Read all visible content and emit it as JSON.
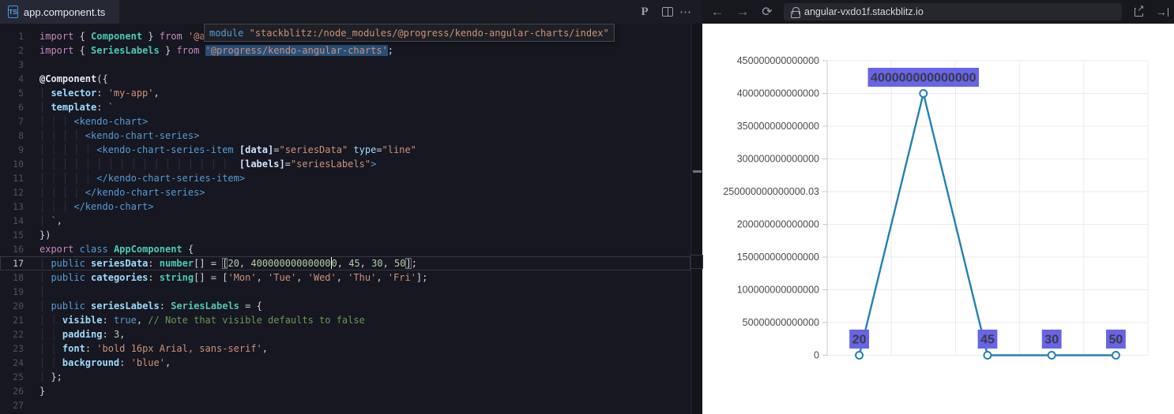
{
  "topbar": {
    "tab": {
      "file_icon": "TS",
      "name": "app.component.ts",
      "modified": true
    },
    "icons": [
      {
        "name": "prettier-icon",
        "glyph": "P"
      },
      {
        "name": "split-editor-icon"
      },
      {
        "name": "more-actions-icon",
        "glyph": "⋯"
      },
      {
        "name": "back-icon",
        "glyph": "←"
      },
      {
        "name": "forward-icon",
        "glyph": "→"
      },
      {
        "name": "refresh-icon",
        "glyph": "⟳"
      },
      {
        "name": "lock-icon"
      },
      {
        "name": "open-external-icon",
        "glyph": "↗"
      },
      {
        "name": "open-right-panel-icon",
        "glyph": "→"
      }
    ],
    "url": "angular-vxdo1f.stackblitz.io"
  },
  "editor": {
    "active_line": 17,
    "tooltip": {
      "tokens": [
        {
          "c": "kw2",
          "x": "module"
        },
        {
          "c": "pun",
          "x": " "
        },
        {
          "c": "str",
          "x": "\"stackblitz:/node_modules/@progress/kendo-angular-charts/index\""
        }
      ]
    },
    "lines": [
      {
        "n": 1,
        "t": [
          {
            "c": "kw1",
            "x": "import"
          },
          {
            "c": "pun",
            "x": " { "
          },
          {
            "c": "ty",
            "x": "Component"
          },
          {
            "c": "pun",
            "x": " } "
          },
          {
            "c": "kw1",
            "x": "from"
          },
          {
            "c": "pun",
            "x": " "
          },
          {
            "c": "str",
            "x": "'@a"
          }
        ]
      },
      {
        "n": 2,
        "t": [
          {
            "c": "kw1",
            "x": "import"
          },
          {
            "c": "pun",
            "x": " { "
          },
          {
            "c": "ty",
            "x": "SeriesLabels"
          },
          {
            "c": "pun",
            "x": " } "
          },
          {
            "c": "kw1",
            "x": "from"
          },
          {
            "c": "pun",
            "x": " "
          },
          {
            "c": "str sel",
            "x": "'@progress/kendo-angular-charts'"
          },
          {
            "c": "pun",
            "x": ";"
          }
        ]
      },
      {
        "n": 3,
        "t": []
      },
      {
        "n": 4,
        "t": [
          {
            "c": "dec",
            "x": "@Component"
          },
          {
            "c": "pun",
            "x": "({"
          }
        ]
      },
      {
        "n": 5,
        "t": [
          {
            "c": "ig",
            "x": "│ "
          },
          {
            "c": "varb",
            "x": "selector"
          },
          {
            "c": "pun",
            "x": ": "
          },
          {
            "c": "str",
            "x": "'my-app'"
          },
          {
            "c": "pun",
            "x": ","
          }
        ]
      },
      {
        "n": 6,
        "t": [
          {
            "c": "ig",
            "x": "│ "
          },
          {
            "c": "varb",
            "x": "template"
          },
          {
            "c": "pun",
            "x": ": "
          },
          {
            "c": "str",
            "x": "`"
          }
        ]
      },
      {
        "n": 7,
        "t": [
          {
            "c": "ig",
            "x": "│ │ │ "
          },
          {
            "c": "tag",
            "x": "<kendo-chart>"
          }
        ]
      },
      {
        "n": 8,
        "t": [
          {
            "c": "ig",
            "x": "│ │ │ │ "
          },
          {
            "c": "tag",
            "x": "<kendo-chart-series>"
          }
        ]
      },
      {
        "n": 9,
        "t": [
          {
            "c": "ig",
            "x": "│ │ │ │ │ "
          },
          {
            "c": "tag",
            "x": "<kendo-chart-series-item "
          },
          {
            "c": "attrb",
            "x": "[data]"
          },
          {
            "c": "pun",
            "x": "="
          },
          {
            "c": "str",
            "x": "\"seriesData\""
          },
          {
            "c": "pun",
            "x": " "
          },
          {
            "c": "var",
            "x": "type"
          },
          {
            "c": "pun",
            "x": "="
          },
          {
            "c": "str",
            "x": "\"line\""
          }
        ]
      },
      {
        "n": 10,
        "t": [
          {
            "c": "ig",
            "x": "│ │ │ │ │ │ │ │ │ │ │ │ │ │ │ │ │ "
          },
          {
            "c": "pun",
            "x": " "
          },
          {
            "c": "attrb",
            "x": "[labels]"
          },
          {
            "c": "pun",
            "x": "="
          },
          {
            "c": "str",
            "x": "\"seriesLabels\""
          },
          {
            "c": "tag",
            "x": ">"
          }
        ]
      },
      {
        "n": 11,
        "t": [
          {
            "c": "ig",
            "x": "│ │ │ │ │ "
          },
          {
            "c": "tag",
            "x": "</kendo-chart-series-item>"
          }
        ]
      },
      {
        "n": 12,
        "t": [
          {
            "c": "ig",
            "x": "│ │ │ │ "
          },
          {
            "c": "tag",
            "x": "</kendo-chart-series>"
          }
        ]
      },
      {
        "n": 13,
        "t": [
          {
            "c": "ig",
            "x": "│ │ │ "
          },
          {
            "c": "tag",
            "x": "</kendo-chart>"
          }
        ]
      },
      {
        "n": 14,
        "t": [
          {
            "c": "ig",
            "x": "│ "
          },
          {
            "c": "str",
            "x": "`"
          },
          {
            "c": "pun",
            "x": ","
          }
        ]
      },
      {
        "n": 15,
        "t": [
          {
            "c": "pun",
            "x": "})"
          }
        ]
      },
      {
        "n": 16,
        "t": [
          {
            "c": "kw1",
            "x": "export"
          },
          {
            "c": "pun",
            "x": " "
          },
          {
            "c": "kw2",
            "x": "class"
          },
          {
            "c": "pun",
            "x": " "
          },
          {
            "c": "ty",
            "x": "AppComponent"
          },
          {
            "c": "pun",
            "x": " {"
          }
        ]
      },
      {
        "n": 17,
        "t": [
          {
            "c": "ig",
            "x": "│ "
          },
          {
            "c": "kw2",
            "x": "public"
          },
          {
            "c": "pun",
            "x": " "
          },
          {
            "c": "varb",
            "x": "seriesData"
          },
          {
            "c": "pun",
            "x": ": "
          },
          {
            "c": "ty",
            "x": "number"
          },
          {
            "c": "pun",
            "x": "[] = "
          },
          {
            "c": "pun bm",
            "x": "["
          },
          {
            "c": "num",
            "x": "20"
          },
          {
            "c": "pun",
            "x": ", "
          },
          {
            "c": "num",
            "x": "40000000000000"
          },
          {
            "c": "cur",
            "x": ""
          },
          {
            "c": "num",
            "x": "0"
          },
          {
            "c": "pun",
            "x": ", "
          },
          {
            "c": "num",
            "x": "45"
          },
          {
            "c": "pun",
            "x": ", "
          },
          {
            "c": "num",
            "x": "30"
          },
          {
            "c": "pun",
            "x": ", "
          },
          {
            "c": "num",
            "x": "50"
          },
          {
            "c": "pun bm",
            "x": "]"
          },
          {
            "c": "pun",
            "x": ";"
          }
        ]
      },
      {
        "n": 18,
        "t": [
          {
            "c": "ig",
            "x": "│ "
          },
          {
            "c": "kw2",
            "x": "public"
          },
          {
            "c": "pun",
            "x": " "
          },
          {
            "c": "varb",
            "x": "categories"
          },
          {
            "c": "pun",
            "x": ": "
          },
          {
            "c": "ty",
            "x": "string"
          },
          {
            "c": "pun",
            "x": "[] = ["
          },
          {
            "c": "str",
            "x": "'Mon'"
          },
          {
            "c": "pun",
            "x": ", "
          },
          {
            "c": "str",
            "x": "'Tue'"
          },
          {
            "c": "pun",
            "x": ", "
          },
          {
            "c": "str",
            "x": "'Wed'"
          },
          {
            "c": "pun",
            "x": ", "
          },
          {
            "c": "str",
            "x": "'Thu'"
          },
          {
            "c": "pun",
            "x": ", "
          },
          {
            "c": "str",
            "x": "'Fri'"
          },
          {
            "c": "pun",
            "x": "];"
          }
        ]
      },
      {
        "n": 19,
        "t": [
          {
            "c": "ig",
            "x": "│ "
          }
        ]
      },
      {
        "n": 20,
        "t": [
          {
            "c": "ig",
            "x": "│ "
          },
          {
            "c": "kw2",
            "x": "public"
          },
          {
            "c": "pun",
            "x": " "
          },
          {
            "c": "varb",
            "x": "seriesLabels"
          },
          {
            "c": "pun",
            "x": ": "
          },
          {
            "c": "ty",
            "x": "SeriesLabels"
          },
          {
            "c": "pun",
            "x": " = {"
          }
        ]
      },
      {
        "n": 21,
        "t": [
          {
            "c": "ig",
            "x": "│ │ "
          },
          {
            "c": "varb",
            "x": "visible"
          },
          {
            "c": "pun",
            "x": ": "
          },
          {
            "c": "kw2",
            "x": "true"
          },
          {
            "c": "pun",
            "x": ", "
          },
          {
            "c": "com",
            "x": "// Note that visible defaults to false"
          }
        ]
      },
      {
        "n": 22,
        "t": [
          {
            "c": "ig",
            "x": "│ │ "
          },
          {
            "c": "varb",
            "x": "padding"
          },
          {
            "c": "pun",
            "x": ": "
          },
          {
            "c": "num",
            "x": "3"
          },
          {
            "c": "pun",
            "x": ","
          }
        ]
      },
      {
        "n": 23,
        "t": [
          {
            "c": "ig",
            "x": "│ │ "
          },
          {
            "c": "varb",
            "x": "font"
          },
          {
            "c": "pun",
            "x": ": "
          },
          {
            "c": "str",
            "x": "'bold 16px Arial, sans-serif'"
          },
          {
            "c": "pun",
            "x": ","
          }
        ]
      },
      {
        "n": 24,
        "t": [
          {
            "c": "ig",
            "x": "│ │ "
          },
          {
            "c": "varb",
            "x": "background"
          },
          {
            "c": "pun",
            "x": ": "
          },
          {
            "c": "str",
            "x": "'blue'"
          },
          {
            "c": "pun",
            "x": ","
          }
        ]
      },
      {
        "n": 25,
        "t": [
          {
            "c": "ig",
            "x": "│ "
          },
          {
            "c": "pun",
            "x": "};"
          }
        ]
      },
      {
        "n": 26,
        "t": [
          {
            "c": "pun",
            "x": "}"
          }
        ]
      },
      {
        "n": 27,
        "t": []
      }
    ]
  },
  "chart_data": {
    "type": "line",
    "values": [
      20,
      400000000000000,
      45,
      30,
      50
    ],
    "point_labels": [
      "20",
      "400000000000000",
      "45",
      "30",
      "50"
    ],
    "y_tick_labels": [
      "450000000000000",
      "400000000000000",
      "350000000000000",
      "300000000000000",
      "250000000000000.03",
      "200000000000000",
      "150000000000000",
      "100000000000000",
      "50000000000000",
      "0"
    ],
    "ylim": [
      0,
      450000000000000
    ],
    "x_tick_labels": [],
    "grid": true,
    "legend": "none",
    "series_color": "#2381b5",
    "marker_fill": "#ffffff",
    "label_bg": "#6764e8",
    "label_text_color": "#3a3a42",
    "grid_color": "#ebebeb",
    "axis_color": "#c8c8c8",
    "tick_text_color": "#4a4a4a"
  }
}
